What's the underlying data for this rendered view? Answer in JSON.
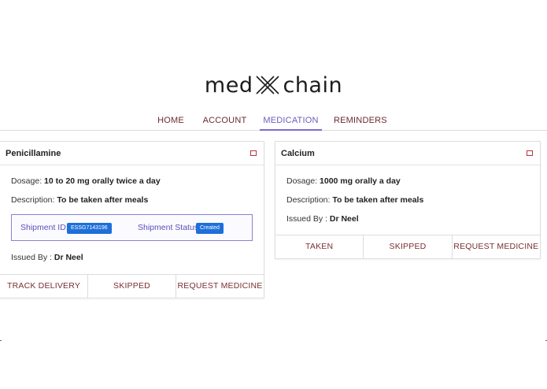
{
  "brand": {
    "left": "med",
    "right": "chain",
    "mark_icon": "double-chevron-logo-icon"
  },
  "nav": {
    "items": [
      {
        "label": "HOME"
      },
      {
        "label": "ACCOUNT"
      },
      {
        "label": "MEDICATION"
      },
      {
        "label": "REMINDERS"
      }
    ],
    "active": "MEDICATION",
    "colors": {
      "item": "#6b2a2f",
      "active": "#6a5bc2"
    }
  },
  "cards": [
    {
      "title": "Penicillamine",
      "dosage_label": "Dosage:",
      "dosage_value": "10 to 20 mg orally twice a day",
      "description_label": "Description:",
      "description_value": "To be taken after meals",
      "shipment": {
        "id_label": "Shipment ID:",
        "id_value": "ESSG7143196",
        "status_label": "Shipment Status:",
        "status_value": "Created"
      },
      "issued_label": "Issued By :",
      "issued_value": "Dr Neel",
      "actions": [
        "TRACK DELIVERY",
        "SKIPPED",
        "REQUEST MEDICINE"
      ]
    },
    {
      "title": "Calcium",
      "dosage_label": "Dosage:",
      "dosage_value": "1000 mg orally a day",
      "description_label": "Description:",
      "description_value": "To be taken after meals",
      "issued_label": "Issued By :",
      "issued_value": "Dr Neel",
      "actions": [
        "TAKEN",
        "SKIPPED",
        "REQUEST MEDICINE"
      ]
    }
  ],
  "colors": {
    "badge": "#1e6fd9",
    "action_text": "#7a2e33",
    "toggle": "#b0353d",
    "ship_border": "#8c7fd6"
  }
}
